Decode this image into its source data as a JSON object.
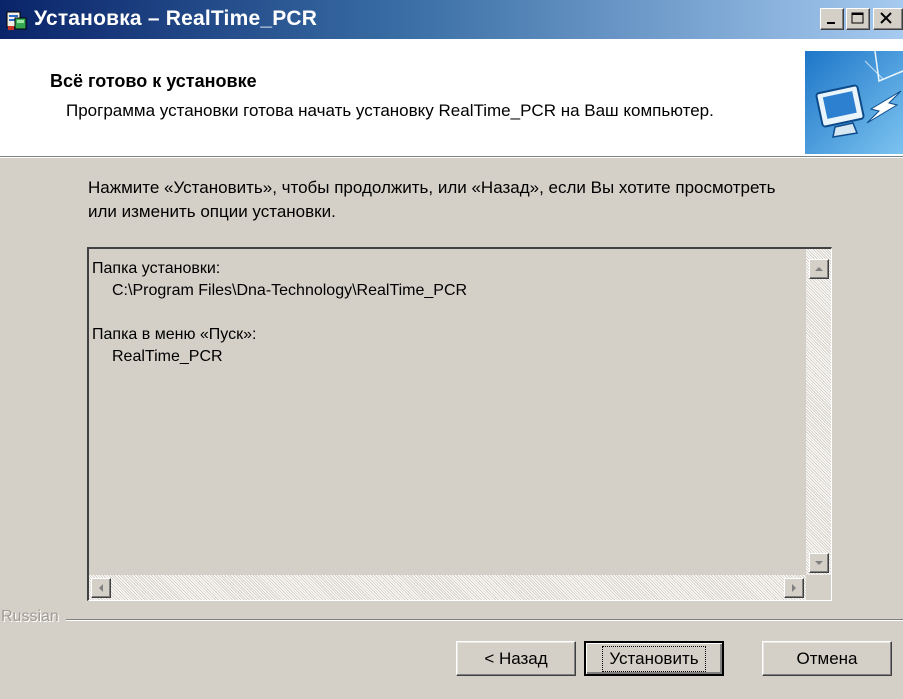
{
  "window": {
    "title": "Установка – RealTime_PCR",
    "controls": [
      "minimize-icon",
      "maximize-icon",
      "close-icon"
    ]
  },
  "header": {
    "title": "Всё готово к установке",
    "description": "Программа установки готова начать установку RealTime_PCR на Ваш компьютер."
  },
  "instruction": "Нажмите «Установить», чтобы продолжить, или «Назад», если Вы хотите просмотреть или изменить опции установки.",
  "summary": {
    "install_folder_label": "Папка установки:",
    "install_folder_value": "C:\\Program Files\\Dna-Technology\\RealTime_PCR",
    "start_menu_label": "Папка в меню «Пуск»:",
    "start_menu_value": "RealTime_PCR"
  },
  "footer": {
    "language": "Russian"
  },
  "buttons": {
    "back": "< Назад",
    "install": "Установить",
    "cancel": "Отмена"
  },
  "colors": {
    "titlebar_start": "#0a246a",
    "titlebar_end": "#a6caf0",
    "face": "#d4d0c8"
  }
}
